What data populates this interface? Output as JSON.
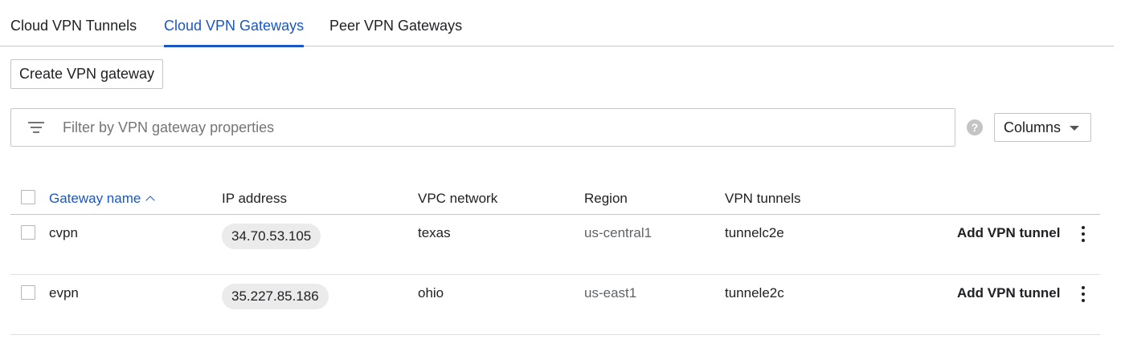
{
  "tabs": [
    {
      "label": "Cloud VPN Tunnels",
      "active": false
    },
    {
      "label": "Cloud VPN Gateways",
      "active": true
    },
    {
      "label": "Peer VPN Gateways",
      "active": false
    }
  ],
  "toolbar": {
    "create_label": "Create VPN gateway"
  },
  "filter": {
    "placeholder": "Filter by VPN gateway properties",
    "value": "",
    "icon": "filter-list-icon"
  },
  "help": {
    "icon": "help-icon",
    "glyph": "?"
  },
  "columns_button": {
    "label": "Columns",
    "icon": "arrow-drop-down-icon"
  },
  "table": {
    "headers": {
      "name": "Gateway name",
      "ip": "IP address",
      "vpc": "VPC network",
      "region": "Region",
      "tunnels": "VPN tunnels"
    },
    "sort": {
      "column": "name",
      "direction": "ascending"
    },
    "rows": [
      {
        "name": "cvpn",
        "ip": "34.70.53.105",
        "vpc": "texas",
        "region": "us-central1",
        "tunnels": "tunnelc2e",
        "action": "Add VPN tunnel"
      },
      {
        "name": "evpn",
        "ip": "35.227.85.186",
        "vpc": "ohio",
        "region": "us-east1",
        "tunnels": "tunnele2c",
        "action": "Add VPN tunnel"
      }
    ]
  },
  "colors": {
    "accent": "#1a56c4",
    "chip": "#ebebeb",
    "border": "#c7c7c7"
  }
}
